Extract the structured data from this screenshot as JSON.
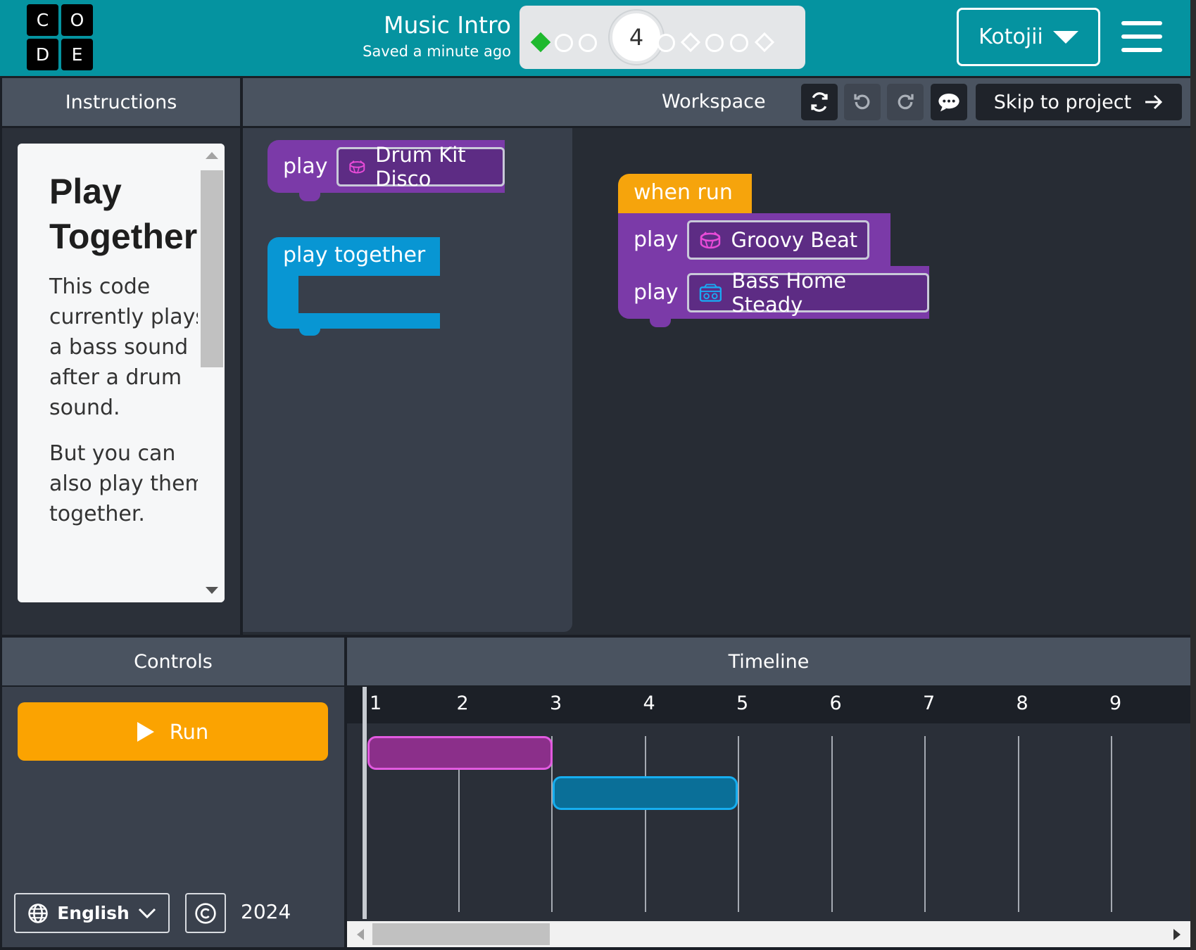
{
  "logo": {
    "letters": [
      "C",
      "O",
      "D",
      "E"
    ]
  },
  "header": {
    "title": "Music Intro",
    "subtitle": "Saved a minute ago",
    "current_level": "4",
    "user_name": "Kotojii",
    "colors": {
      "bar": "#0593a0",
      "completed": "#1fb92e"
    }
  },
  "instructions": {
    "header": "Instructions",
    "heading": "Play Together",
    "paragraphs": [
      "This code currently plays a bass sound after a drum sound.",
      "But you can also play them together."
    ]
  },
  "workspace": {
    "header": "Workspace",
    "skip_label": "Skip to project",
    "toolbox": {
      "play_label": "play",
      "play_sound": "Drum Kit Disco",
      "together_label": "play together"
    },
    "program": {
      "event_label": "when run",
      "blocks": [
        {
          "label": "play",
          "sound": "Groovy Beat",
          "icon": "drum-icon"
        },
        {
          "label": "play",
          "sound": "Bass Home Steady",
          "icon": "radio-icon"
        }
      ]
    },
    "colors": {
      "play_block": "#7b3aa8",
      "event_block": "#f6a40c",
      "together_block": "#0896d3"
    }
  },
  "controls": {
    "header": "Controls",
    "run_label": "Run",
    "language": "English",
    "year": "2024",
    "run_color": "#fba301"
  },
  "timeline": {
    "header": "Timeline",
    "measures": [
      "1",
      "2",
      "3",
      "4",
      "5",
      "6",
      "7",
      "8",
      "9"
    ],
    "clips": [
      {
        "name": "Groovy Beat",
        "start": 1,
        "end": 3,
        "color": "#8b2f8a",
        "border": "#e25ae0"
      },
      {
        "name": "Bass Home Steady",
        "start": 3,
        "end": 5,
        "color": "#0a6f98",
        "border": "#16aef0"
      }
    ]
  }
}
